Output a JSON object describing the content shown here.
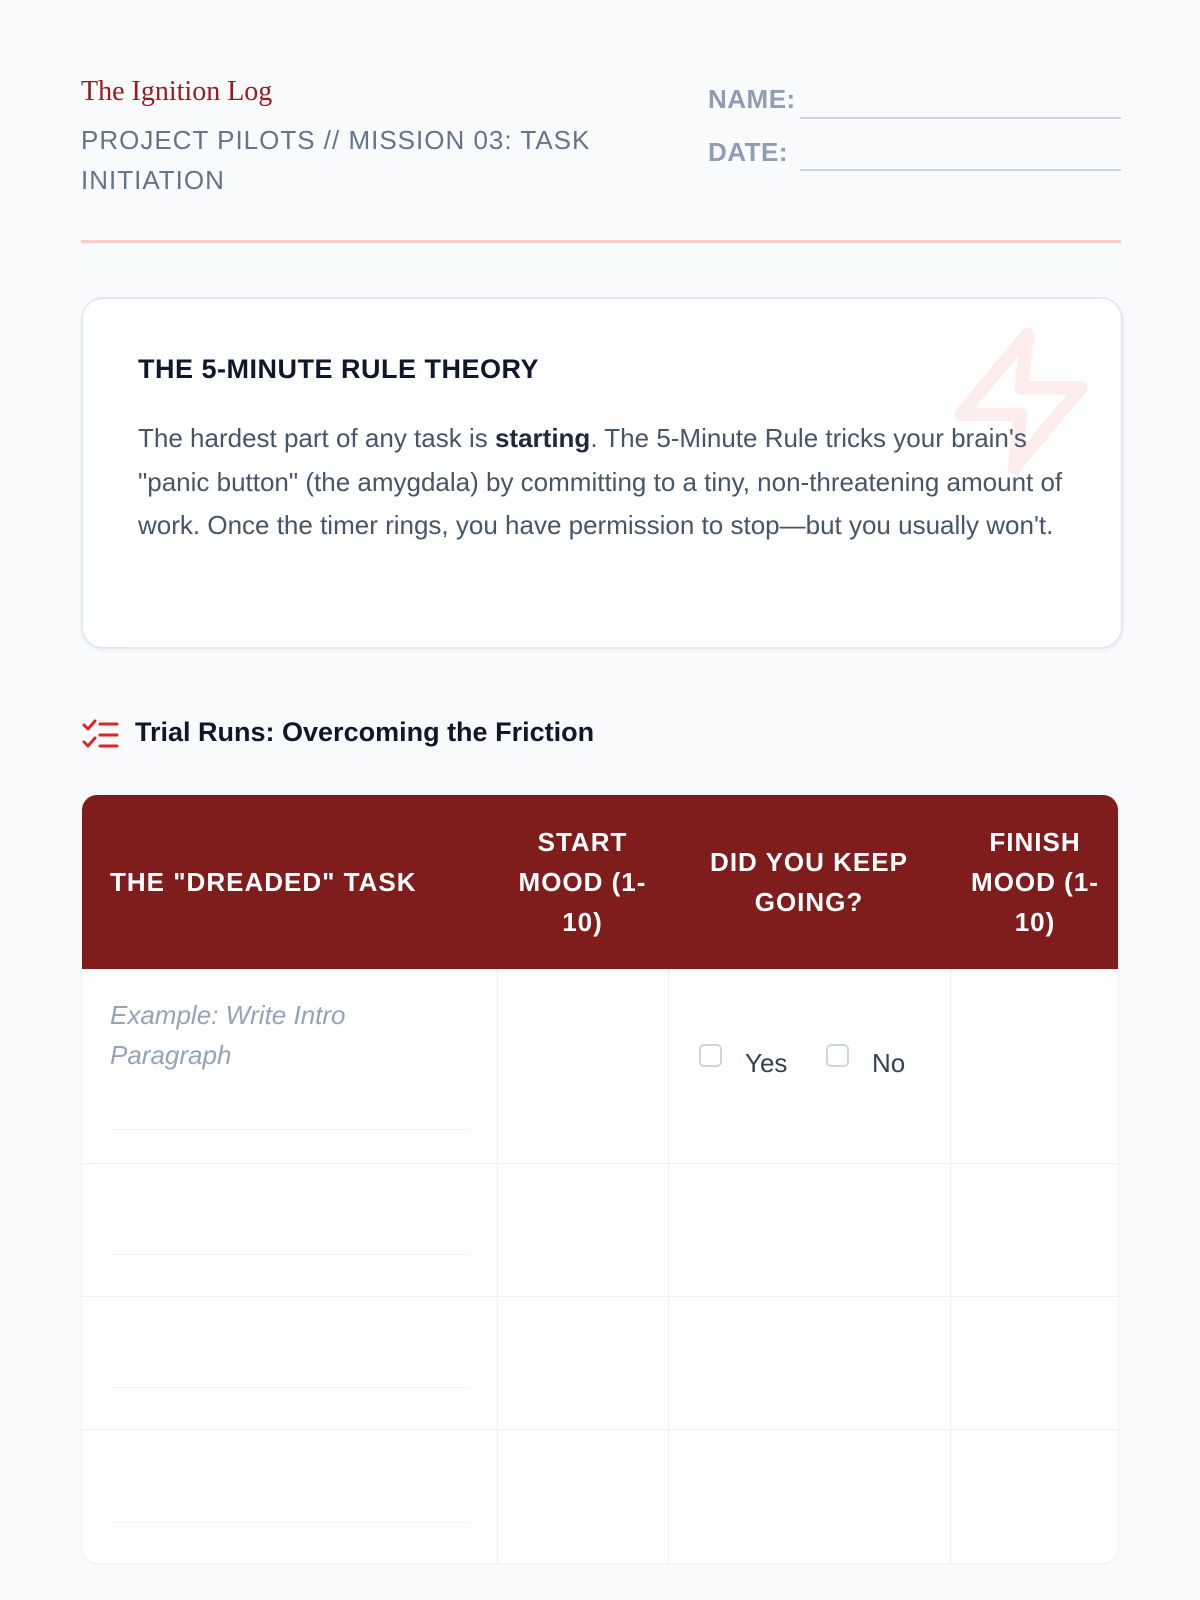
{
  "header": {
    "brand": "The Ignition Log",
    "subtitle": "PROJECT PILOTS // MISSION 03: TASK INITIATION",
    "name_label": "NAME:",
    "date_label": "DATE:"
  },
  "theory": {
    "title": "THE 5-MINUTE RULE THEORY",
    "body_before": "The hardest part of any task is ",
    "body_bold": "starting",
    "body_after": ". The 5-Minute Rule tricks your brain's \"panic button\" (the amygdala) by committing to a tiny, non-threatening amount of work. Once the timer rings, you have permission to stop—but you usually won't.",
    "accent_icon": "lightning-bolt-icon"
  },
  "section": {
    "icon": "checklist-icon",
    "title": "Trial Runs: Overcoming the Friction"
  },
  "table": {
    "headers": [
      "THE \"DREADED\" TASK",
      "START MOOD (1-10)",
      "DID YOU KEEP GOING?",
      "FINISH MOOD (1-10)"
    ],
    "example_task": "Example: Write Intro Paragraph",
    "yes_label": "Yes",
    "no_label": "No",
    "empty_rows": 3
  },
  "colors": {
    "accent": "#991b1b",
    "header_bg": "#7f1d1d",
    "rule": "#fecaca",
    "page_bg": "#f8fafc"
  }
}
